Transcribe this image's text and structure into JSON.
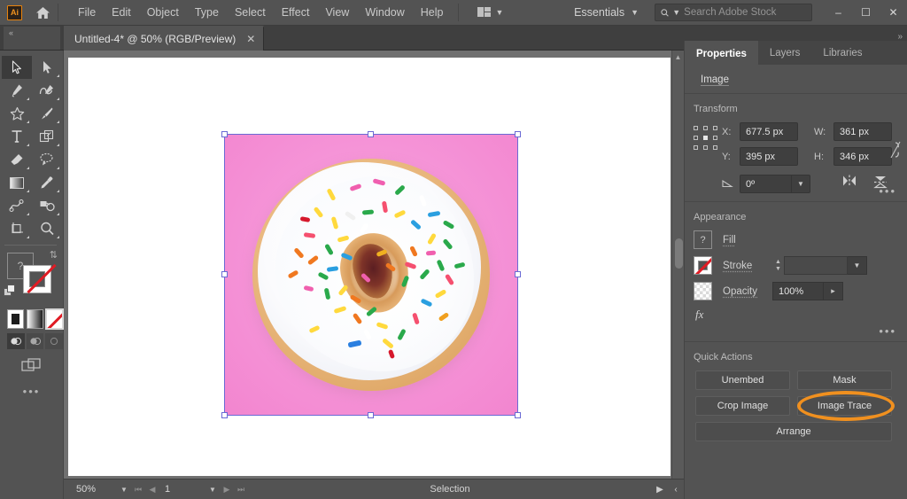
{
  "app": {
    "name": "Adobe Illustrator",
    "logo_text": "Ai"
  },
  "menubar": {
    "home_icon": "home-icon",
    "items": [
      "File",
      "Edit",
      "Object",
      "Type",
      "Select",
      "Effect",
      "View",
      "Window",
      "Help"
    ],
    "arrange_documents_icon": "arrange-documents-icon",
    "workspace": "Essentials",
    "search": {
      "placeholder": "Search Adobe Stock",
      "value": "",
      "icon": "search-icon"
    },
    "window_controls": {
      "minimize": "–",
      "maximize": "☐",
      "close": "✕"
    }
  },
  "tabbar": {
    "collapse_icon": "«",
    "document_title": "Untitled-4* @ 50% (RGB/Preview)",
    "close_icon": "✕",
    "expand_panel_icon": "»"
  },
  "toolbar": {
    "tools": [
      {
        "name": "selection-tool",
        "active": true
      },
      {
        "name": "direct-selection-tool",
        "active": false
      },
      {
        "name": "pen-tool",
        "active": false
      },
      {
        "name": "curvature-tool",
        "active": false
      },
      {
        "name": "star-tool",
        "active": false
      },
      {
        "name": "paintbrush-tool",
        "active": false
      },
      {
        "name": "type-tool",
        "active": false
      },
      {
        "name": "shape-builder-tool",
        "active": false
      },
      {
        "name": "eraser-tool",
        "active": false
      },
      {
        "name": "lasso-tool",
        "active": false
      },
      {
        "name": "gradient-tool",
        "active": false
      },
      {
        "name": "eyedropper-tool",
        "active": false
      },
      {
        "name": "blend-tool",
        "active": false
      },
      {
        "name": "symbol-sprayer-tool",
        "active": false
      },
      {
        "name": "artboard-tool",
        "active": false
      },
      {
        "name": "zoom-tool",
        "active": false
      }
    ],
    "fill_label": "?",
    "stroke_state": "none",
    "color_modes": [
      "color",
      "gradient",
      "none"
    ],
    "color_mode_selected": "none",
    "draw_modes": [
      "draw-normal",
      "draw-behind",
      "draw-inside"
    ],
    "draw_mode_selected": "draw-normal",
    "screen_mode_icon": "screen-mode-icon",
    "more_tools": "•••"
  },
  "canvas": {
    "artwork_alt": "donut-with-sprinkles-on-pink-background",
    "selection_handles": 8,
    "background_color": "#f593d7"
  },
  "statusbar": {
    "zoom_value": "50%",
    "page_value": "1",
    "status_text": "Selection",
    "nav_first": "⏮",
    "nav_prev": "◀",
    "nav_next": "▶",
    "nav_last": "⏭",
    "play_icon": "▶",
    "left_icon": "‹"
  },
  "properties_panel": {
    "tabs": [
      {
        "label": "Properties",
        "active": true
      },
      {
        "label": "Layers",
        "active": false
      },
      {
        "label": "Libraries",
        "active": false
      }
    ],
    "object_type": "Image",
    "transform": {
      "label": "Transform",
      "x_label": "X:",
      "x_value": "677.5 px",
      "y_label": "Y:",
      "y_value": "395 px",
      "w_label": "W:",
      "w_value": "361 px",
      "h_label": "H:",
      "h_value": "346 px",
      "angle_label": "△:",
      "angle_value": "0º",
      "link_icon": "constrain-proportions-icon",
      "flip_h_icon": "flip-horizontal-icon",
      "flip_v_icon": "flip-vertical-icon",
      "more_icon": "•••"
    },
    "appearance": {
      "label": "Appearance",
      "fill_label": "Fill",
      "fill_swatch": "?",
      "stroke_label": "Stroke",
      "stroke_value": "",
      "opacity_label": "Opacity",
      "opacity_value": "100%",
      "fx_label": "fx",
      "more_icon": "•••"
    },
    "quick_actions": {
      "label": "Quick Actions",
      "buttons": [
        "Unembed",
        "Mask",
        "Crop Image",
        "Image Trace",
        "Arrange"
      ],
      "highlighted_button": "Image Trace",
      "highlight_color": "#f0901f"
    }
  }
}
